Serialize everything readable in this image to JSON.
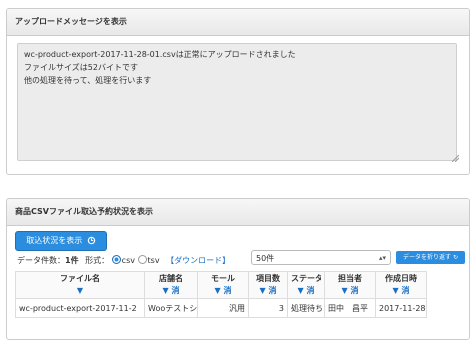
{
  "upload_panel": {
    "title": "アップロードメッセージを表示",
    "lines": [
      "wc-product-export-2017-11-28-01.csvは正常にアップロードされました",
      "ファイルサイズは52バイトです",
      "他の処理を待って、処理を行います"
    ]
  },
  "status_panel": {
    "title": "商品CSVファイル取込予約状況を表示",
    "show_button": "取込状況を表示",
    "count_label": "データ件数：",
    "count_value": "1件",
    "format_label": "形式：",
    "format_options": [
      "csv",
      "tsv"
    ],
    "download_link": "【ダウンロード】",
    "per_page": "50件",
    "wrap_button": "データを折り返す",
    "columns": [
      {
        "label": "ファイル名",
        "sort": "▼"
      },
      {
        "label": "店舗名",
        "sort": "▼ 消"
      },
      {
        "label": "モール",
        "sort": "▼ 消"
      },
      {
        "label": "項目数",
        "sort": "▼ 消"
      },
      {
        "label": "ステータス",
        "sort": "▼ 消"
      },
      {
        "label": "担当者",
        "sort": "▼ 消"
      },
      {
        "label": "作成日時",
        "sort": "▼ 消"
      }
    ],
    "rows": [
      [
        "wc-product-export-2017-11-2",
        "Wooテストショ",
        "汎用",
        "3",
        "処理待ち",
        "田中　昌平",
        "2017-11-28"
      ]
    ]
  }
}
